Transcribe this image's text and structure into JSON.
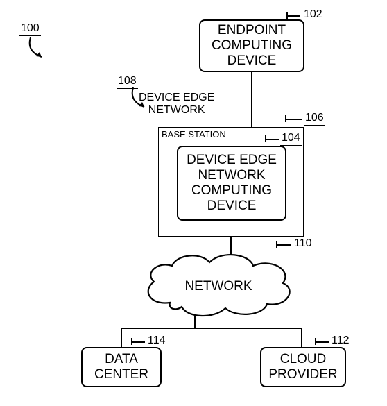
{
  "figure_ref": "100",
  "nodes": {
    "endpoint": {
      "label": "ENDPOINT\nCOMPUTING\nDEVICE",
      "ref": "102"
    },
    "dencd": {
      "label": "DEVICE EDGE\nNETWORK\nCOMPUTING\nDEVICE",
      "ref": "104"
    },
    "base_station": {
      "label": "BASE STATION",
      "ref": "106"
    },
    "network": {
      "label": "NETWORK",
      "ref": "110"
    },
    "data_center": {
      "label": "DATA\nCENTER",
      "ref": "114"
    },
    "cloud_provider": {
      "label": "CLOUD\nPROVIDER",
      "ref": "112"
    }
  },
  "edge_label": {
    "text": "DEVICE EDGE\nNETWORK",
    "ref": "108"
  }
}
